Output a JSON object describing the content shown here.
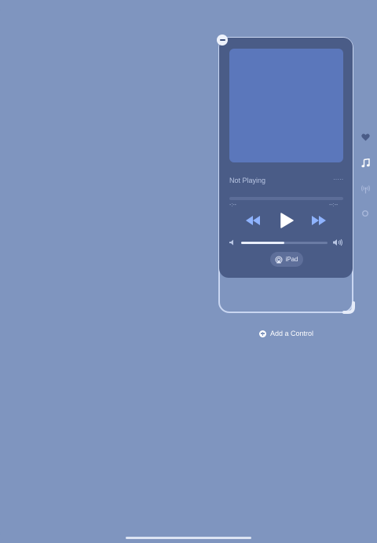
{
  "now_playing": {
    "title": "Not Playing",
    "more": "·····",
    "time_elapsed": "-:--",
    "time_remaining": "--:--",
    "volume_level": 0.5,
    "route_label": "iPad"
  },
  "side_icons": [
    "heart-icon",
    "music-note-icon",
    "antenna-icon",
    "circle-icon"
  ],
  "add_control": {
    "label": "Add a Control"
  },
  "colors": {
    "background": "#7f95bf",
    "player_bg": "#4a5c87",
    "artwork": "#5b77bb",
    "accent": "#8fb3ff"
  }
}
